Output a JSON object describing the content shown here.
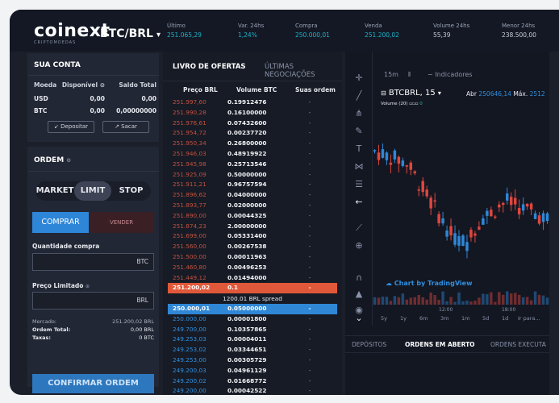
{
  "header": {
    "logo": "coinext",
    "logo_sub": "CRIPTOMOEDAS",
    "pair": "BTC/BRL",
    "pair_caret": "▾",
    "stats": [
      {
        "label": "Último",
        "value": "251.065,29"
      },
      {
        "label": "Var. 24hs",
        "value": "1,24%"
      },
      {
        "label": "Compra",
        "value": "250.000,01"
      },
      {
        "label": "Venda",
        "value": "251.200,02"
      },
      {
        "label": "Volume 24hs",
        "value": "55,39"
      },
      {
        "label": "Menor 24hs",
        "value": "238.500,00"
      }
    ]
  },
  "account": {
    "title": "SUA CONTA",
    "head_moeda": "Moeda",
    "head_disp": "Disponível",
    "head_total": "Saldo Total",
    "rows": [
      {
        "coin": "USD",
        "avail": "0,00",
        "total": "0,00"
      },
      {
        "coin": "BTC",
        "avail": "0,00",
        "total": "0,00000000"
      }
    ],
    "deposit_label": "Depositar",
    "withdraw_label": "Sacar"
  },
  "order": {
    "title": "ORDEM",
    "types": [
      "MARKET",
      "LIMIT",
      "STOP"
    ],
    "active_type": "LIMIT",
    "buy_label": "COMPRAR",
    "sell_label": "VENDER",
    "qty_label": "Quantidade compra",
    "qty_unit": "BTC",
    "price_label": "Preço Limitado",
    "price_unit": "BRL",
    "market_label": "Mercado:",
    "market_value": "251.200,02 BRL",
    "total_label": "Ordem Total:",
    "total_value": "0,00 BRL",
    "fees_label": "Taxas:",
    "fees_value": "0 BTC",
    "confirm_label": "CONFIRMAR ORDEM"
  },
  "book": {
    "tab_active": "LIVRO DE OFERTAS",
    "tab_inactive": "ÚLTIMAS NEGOCIAÇÕES",
    "col_price": "Preço BRL",
    "col_volume": "Volume BTC",
    "col_orders": "Suas ordem",
    "asks": [
      {
        "p": "251.997,60",
        "q": "0.19912476",
        "o": "-"
      },
      {
        "p": "251.990,28",
        "q": "0.16100000",
        "o": "-"
      },
      {
        "p": "251.976,61",
        "q": "0.07432600",
        "o": "-"
      },
      {
        "p": "251.954,72",
        "q": "0.00237720",
        "o": "-"
      },
      {
        "p": "251.950,34",
        "q": "0.26800000",
        "o": "-"
      },
      {
        "p": "251.946,03",
        "q": "0.48919922",
        "o": "-"
      },
      {
        "p": "251.945,98",
        "q": "0.25713546",
        "o": "-"
      },
      {
        "p": "251.925,09",
        "q": "0.50000000",
        "o": "-"
      },
      {
        "p": "251.911,21",
        "q": "0.96757594",
        "o": "-"
      },
      {
        "p": "251.896,62",
        "q": "0.04000000",
        "o": "-"
      },
      {
        "p": "251.893,77",
        "q": "0.02000000",
        "o": "-"
      },
      {
        "p": "251.890,00",
        "q": "0.00044325",
        "o": "-"
      },
      {
        "p": "251.874,23",
        "q": "2.00000000",
        "o": "-"
      },
      {
        "p": "251.699,00",
        "q": "0.05331400",
        "o": "-"
      },
      {
        "p": "251.560,00",
        "q": "0.00267538",
        "o": "-"
      },
      {
        "p": "251.500,00",
        "q": "0.00011963",
        "o": "-"
      },
      {
        "p": "251.460,80",
        "q": "0.00496253",
        "o": "-"
      },
      {
        "p": "251.449,12",
        "q": "0.01494000",
        "o": "-"
      },
      {
        "p": "251.200,02",
        "q": "0.1",
        "o": "-"
      }
    ],
    "spread": "1200.01 BRL spread",
    "bids": [
      {
        "p": "250.000,01",
        "q": "0.05000000",
        "o": "-"
      },
      {
        "p": "250.000,00",
        "q": "0.00001800",
        "o": "-"
      },
      {
        "p": "249.700,00",
        "q": "0.10357865",
        "o": "-"
      },
      {
        "p": "249.253,03",
        "q": "0.00004011",
        "o": "-"
      },
      {
        "p": "249.253,02",
        "q": "0.03344651",
        "o": "-"
      },
      {
        "p": "249.253,00",
        "q": "0.00305729",
        "o": "-"
      },
      {
        "p": "249.200,03",
        "q": "0.04961129",
        "o": "-"
      },
      {
        "p": "249.200,02",
        "q": "0.01668772",
        "o": "-"
      },
      {
        "p": "249.200,00",
        "q": "0.00042522",
        "o": "-"
      }
    ]
  },
  "chart": {
    "interval": "15m",
    "indicators_label": "Indicadores",
    "symbol": "BTCBRL, 15",
    "open_label": "Abr",
    "open_value": "250646,14",
    "max_label": "Máx.",
    "max_value": "2512",
    "volume_label": "Volume (20)",
    "volume_value": "0",
    "tradingview_label": "Chart by TradingView",
    "x_labels": [
      "12:00",
      "18:00"
    ],
    "ranges": [
      "5y",
      "1y",
      "6m",
      "3m",
      "1m",
      "5d",
      "1d",
      "Ir para..."
    ],
    "bottom_tabs": [
      "DEPÓSITOS",
      "ORDENS EM ABERTO",
      "ORDENS EXECUTA"
    ],
    "bottom_active": "ORDENS EM ABERTO",
    "colors": {
      "up": "#2f87d6",
      "down": "#e0463d",
      "accent": "#2f87d6"
    }
  }
}
